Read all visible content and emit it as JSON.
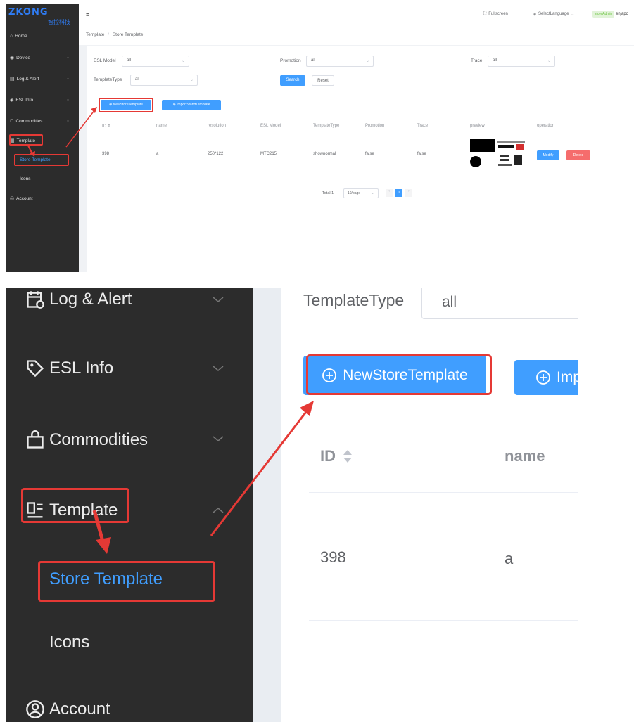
{
  "top": {
    "logo": {
      "text": "ZKONG",
      "subtitle": "智控科技"
    },
    "sidebar": {
      "items": [
        {
          "label": "Home",
          "icon": "home-icon"
        },
        {
          "label": "Device",
          "icon": "device-icon"
        },
        {
          "label": "Log & Alert",
          "icon": "log-icon"
        },
        {
          "label": "ESL Info",
          "icon": "tag-icon"
        },
        {
          "label": "Commodities",
          "icon": "bag-icon"
        },
        {
          "label": "Template",
          "icon": "template-icon"
        }
      ],
      "sub_items": [
        {
          "label": "Store Template"
        },
        {
          "label": "Icons"
        }
      ],
      "account": {
        "label": "Account",
        "icon": "user-icon"
      }
    },
    "header": {
      "fullscreen": "Fullscreen",
      "language": "SelectLanguage",
      "user_badge": "storeAdmin",
      "user": "enjapo"
    },
    "breadcrumb": {
      "parent": "Template",
      "sep": "/",
      "current": "Store Template"
    },
    "filters": {
      "esl_model_label": "ESL Model",
      "esl_model_value": "all",
      "promotion_label": "Promotion",
      "promotion_value": "all",
      "trace_label": "Trace",
      "trace_value": "all",
      "template_type_label": "TemplateType",
      "template_type_value": "all",
      "search": "Search",
      "reset": "Reset"
    },
    "actions": {
      "new": "NewStoreTemplate",
      "import": "ImportStandTemplate"
    },
    "table": {
      "headers": [
        "ID",
        "name",
        "resolution",
        "ESL Model",
        "TemplateType",
        "Promotion",
        "Trace",
        "preview",
        "operation"
      ],
      "row": {
        "id": "398",
        "name": "a",
        "resolution": "250*122",
        "model": "MTC215",
        "type": "shownormal",
        "promotion": "false",
        "trace": "false",
        "modify": "Modify",
        "delete": "Delete"
      }
    },
    "pagination": {
      "total": "Total 1",
      "page_size": "10/page",
      "current_page": "1"
    }
  },
  "bottom": {
    "sidebar": {
      "items": [
        {
          "label": "Log & Alert",
          "icon": "calendar-icon"
        },
        {
          "label": "ESL Info",
          "icon": "tag-icon"
        },
        {
          "label": "Commodities",
          "icon": "bag-icon"
        },
        {
          "label": "Template",
          "icon": "template-icon"
        }
      ],
      "sub_items": [
        {
          "label": "Store Template"
        },
        {
          "label": "Icons"
        }
      ],
      "account": {
        "label": "Account",
        "icon": "user-icon"
      }
    },
    "template_type_label": "TemplateType",
    "template_type_value": "all",
    "new_button": "NewStoreTemplate",
    "import_button_partial": "Imp",
    "table_headers": [
      "ID",
      "name"
    ],
    "row": {
      "id": "398",
      "name": "a"
    }
  },
  "colors": {
    "accent": "#409eff",
    "sidebar_bg": "#2c2c2c",
    "highlight": "#e53935",
    "danger": "#f56c6c"
  }
}
